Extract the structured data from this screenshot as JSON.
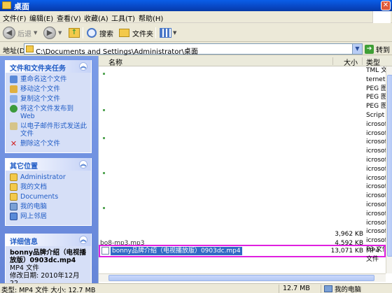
{
  "window": {
    "title": "桌面"
  },
  "menu": [
    "文件(F)",
    "编辑(E)",
    "查看(V)",
    "收藏(A)",
    "工具(T)",
    "帮助(H)"
  ],
  "toolbar": {
    "back": "后退",
    "search": "搜索",
    "folders": "文件夹"
  },
  "address": {
    "label": "地址(D)",
    "path": "C:\\Documents and Settings\\Administrator\\桌面",
    "go": "转到"
  },
  "tasks": {
    "file_tasks": {
      "title": "文件和文件夹任务",
      "items": [
        "重命名这个文件",
        "移动这个文件",
        "复制这个文件",
        "将这个文件发布到 Web",
        "以电子邮件形式发送此文件",
        "删除这个文件"
      ]
    },
    "other_places": {
      "title": "其它位置",
      "items": [
        "Administrator",
        "我的文档",
        "Documents",
        "我的电脑",
        "网上邻居"
      ]
    },
    "details": {
      "title": "详细信息",
      "name": "bonny品牌介绍（电视播放版）0903dc.mp4",
      "type": "MP4 文件",
      "modified": "修改日期: 2010年12月22"
    }
  },
  "columns": {
    "name": "名称",
    "size": "大小",
    "type": "类型"
  },
  "type_column": [
    "TML 文",
    "ternet f",
    "PEG 图",
    "PEG 图",
    "PEG 图",
    "Script Sc",
    "icrosoft",
    "icrosoft",
    "icrosoft",
    "icrosoft",
    "icrosoft",
    "icrosoft",
    "icrosoft",
    "icrosoft",
    "icrosoft",
    "icrosoft",
    "icrosoft",
    "icrosoft",
    "icrosoft",
    "icrosoft",
    "P3 文件"
  ],
  "partial_row": {
    "name": "bo8-mp3.mp3",
    "size": "4,592 KB",
    "size_prev": "3,962 KB"
  },
  "selected_file": {
    "name": "bonny品牌介绍（电视播放版）0903dc.mp4",
    "size": "13,071 KB",
    "type": "MP4 文件"
  },
  "status": {
    "left": "类型: MP4 文件 大小: 12.7 MB",
    "size": "12.7 MB",
    "location": "我的电脑"
  }
}
